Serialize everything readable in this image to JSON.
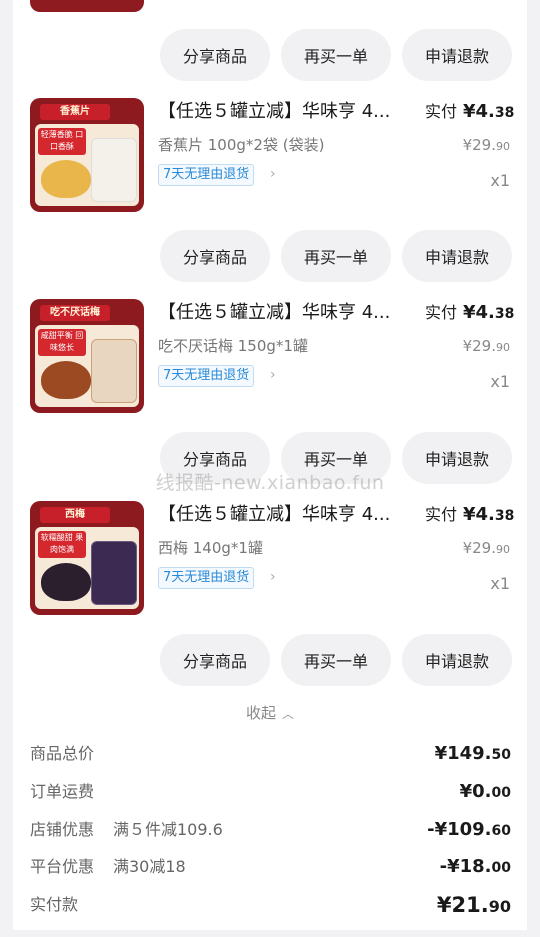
{
  "actions": {
    "share_label": "分享商品",
    "rebuy_label": "再买一单",
    "refund_label": "申请退款"
  },
  "items": [
    {
      "title": "【任选５罐立减】华味亨 4...",
      "thumb_tag": "香蕉片",
      "thumb_slogan": "轻薄香脆 口口香酥",
      "pay_label": "实付",
      "pay_int": "¥4.",
      "pay_dec": "38",
      "spec": "香蕉片 100g*2袋 (袋装)",
      "orig_int": "¥29.",
      "orig_dec": "90",
      "badge": "7天无理由退货",
      "qty": "x1",
      "colors": {
        "food": "#e8b64a",
        "jar": "#f4f0ea"
      }
    },
    {
      "title": "【任选５罐立减】华味亨 4...",
      "thumb_tag": "吃不厌话梅",
      "thumb_slogan": "咸甜平衡 回味悠长",
      "pay_label": "实付",
      "pay_int": "¥4.",
      "pay_dec": "38",
      "spec": "吃不厌话梅 150g*1罐",
      "orig_int": "¥29.",
      "orig_dec": "90",
      "badge": "7天无理由退货",
      "qty": "x1",
      "colors": {
        "food": "#9c4a22",
        "jar": "#e9d6c0"
      }
    },
    {
      "title": "【任选５罐立减】华味亨 4...",
      "thumb_tag": "西梅",
      "thumb_slogan": "软糯酸甜 果肉饱满",
      "pay_label": "实付",
      "pay_int": "¥4.",
      "pay_dec": "38",
      "spec": "西梅 140g*1罐",
      "orig_int": "¥29.",
      "orig_dec": "90",
      "badge": "7天无理由退货",
      "qty": "x1",
      "colors": {
        "food": "#2b1f2e",
        "jar": "#3c2a52"
      }
    }
  ],
  "collapse_label": "收起",
  "summary": {
    "goods_total": {
      "label": "商品总价",
      "int": "¥149.",
      "dec": "50"
    },
    "shipping": {
      "label": "订单运费",
      "int": "¥0.",
      "dec": "00"
    },
    "store_discount": {
      "label": "店铺优惠",
      "note": "满５件减109.6",
      "int": "-¥109.",
      "dec": "60"
    },
    "platform_discount": {
      "label": "平台优惠",
      "note": "满30减18",
      "int": "-¥18.",
      "dec": "00"
    },
    "paid": {
      "label": "实付款",
      "int": "¥21.",
      "dec": "90"
    }
  },
  "watermark": "线报酷-new.xianbao.fun",
  "theme": {
    "brand": "#8c1a1f",
    "link": "#2b8ad6",
    "pill_bg": "#f1f1f3"
  }
}
